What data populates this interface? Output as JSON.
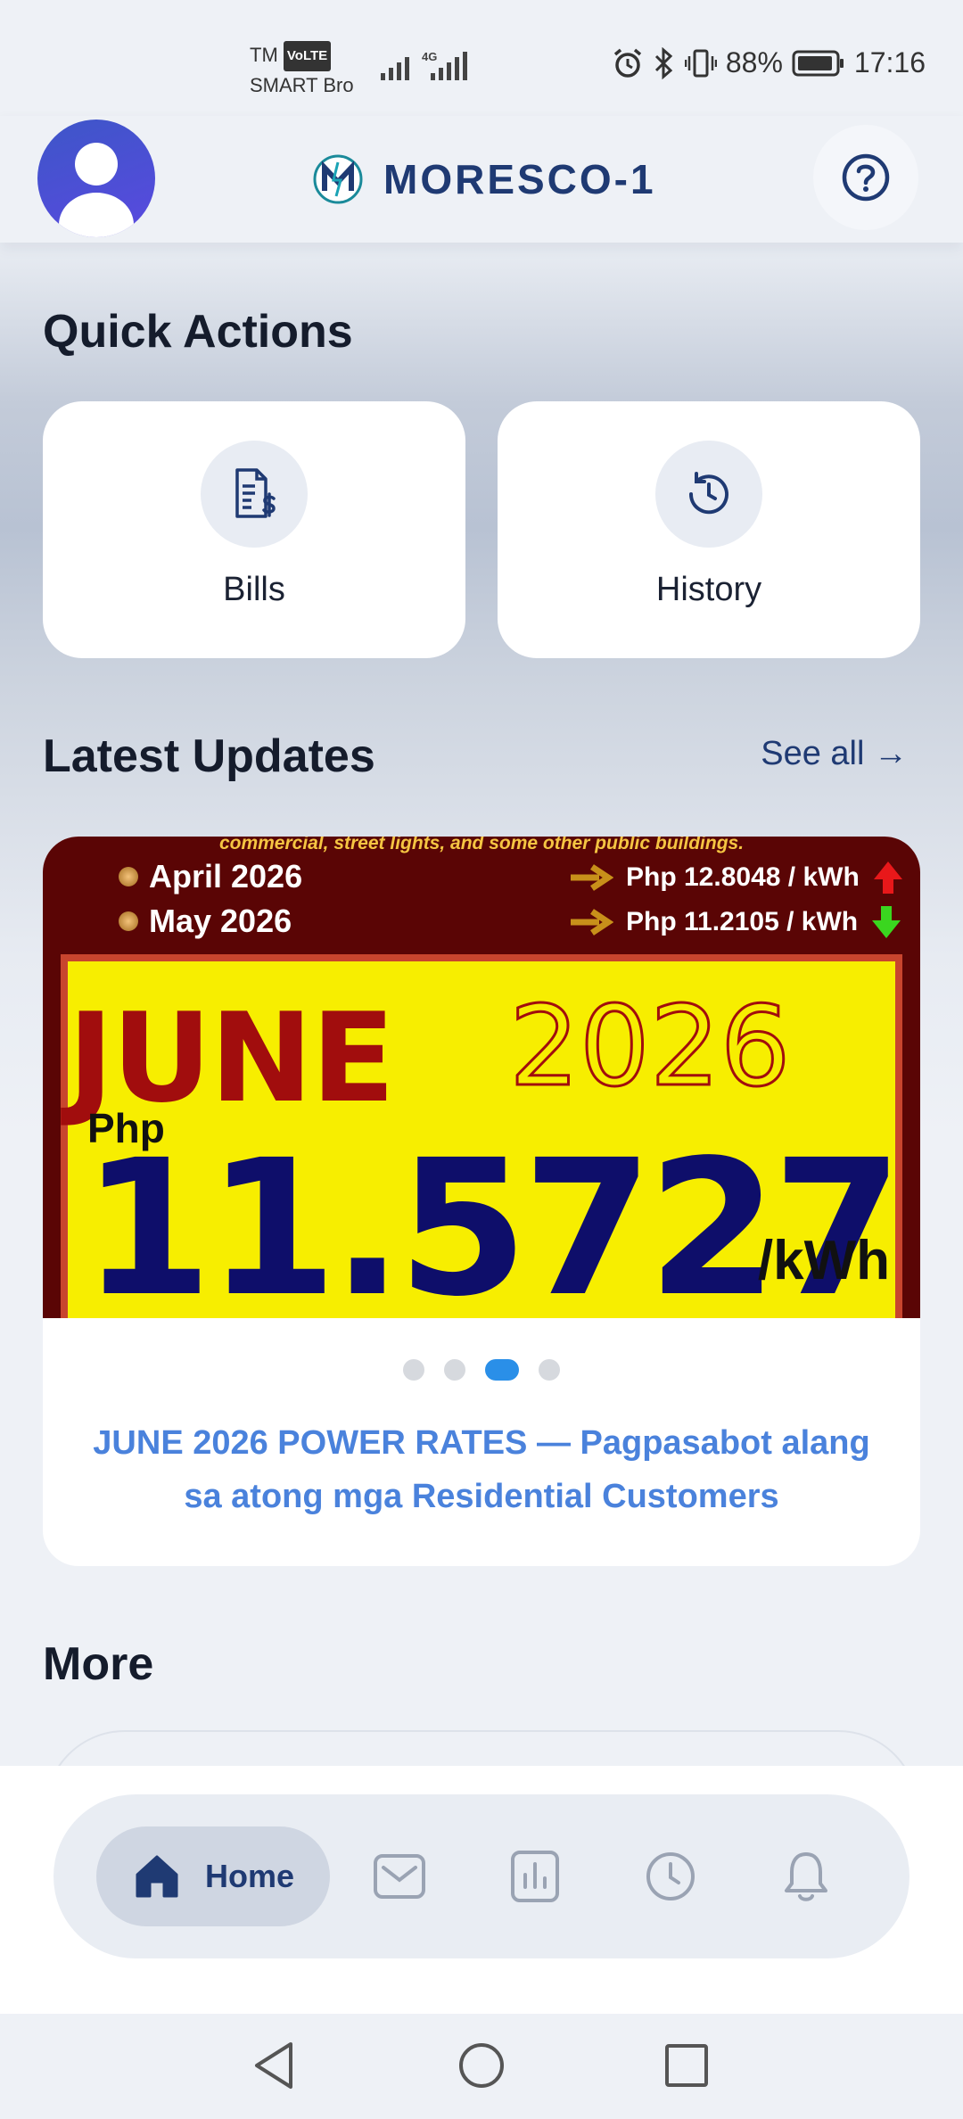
{
  "status_bar": {
    "carrier_line1": "TM",
    "volte_badge": "VoLTE",
    "carrier_line2": "SMART Bro",
    "network_type": "4G",
    "battery_percent": "88%",
    "time": "17:16"
  },
  "header": {
    "brand_name": "MORESCO-1"
  },
  "quick_actions": {
    "title": "Quick Actions",
    "items": [
      {
        "label": "Bills",
        "icon": "bill-dollar-icon"
      },
      {
        "label": "History",
        "icon": "history-clock-icon"
      }
    ]
  },
  "latest_updates": {
    "title": "Latest Updates",
    "see_all": "See all →",
    "banner": {
      "top_text": "commercial, street lights, and some other public buildings.",
      "rates": [
        {
          "month": "April 2026",
          "value": "Php 12.8048 / kWh",
          "trend": "up"
        },
        {
          "month": "May 2026",
          "value": "Php 11.2105 / kWh",
          "trend": "down"
        }
      ],
      "headline_month": "JUNE",
      "headline_year": "2026",
      "currency": "Php",
      "big_rate": "11.5727",
      "unit": "/kWh"
    },
    "carousel": {
      "count": 4,
      "active_index": 2
    },
    "post_title": "JUNE 2026 POWER RATES — Pagpasabot alang sa atong mga Residential Customers"
  },
  "more": {
    "title": "More"
  },
  "bottom_nav": {
    "items": [
      {
        "label": "Home",
        "icon": "home-icon",
        "active": true
      },
      {
        "label": "",
        "icon": "mail-icon",
        "active": false
      },
      {
        "label": "",
        "icon": "bar-chart-icon",
        "active": false
      },
      {
        "label": "",
        "icon": "clock-icon",
        "active": false
      },
      {
        "label": "",
        "icon": "bell-icon",
        "active": false
      }
    ]
  },
  "colors": {
    "brand_navy": "#1f3a73",
    "accent_blue": "#2a8fe8",
    "link_blue": "#4a82dc",
    "banner_red": "#a10d0d",
    "banner_yellow": "#f7ee00"
  }
}
